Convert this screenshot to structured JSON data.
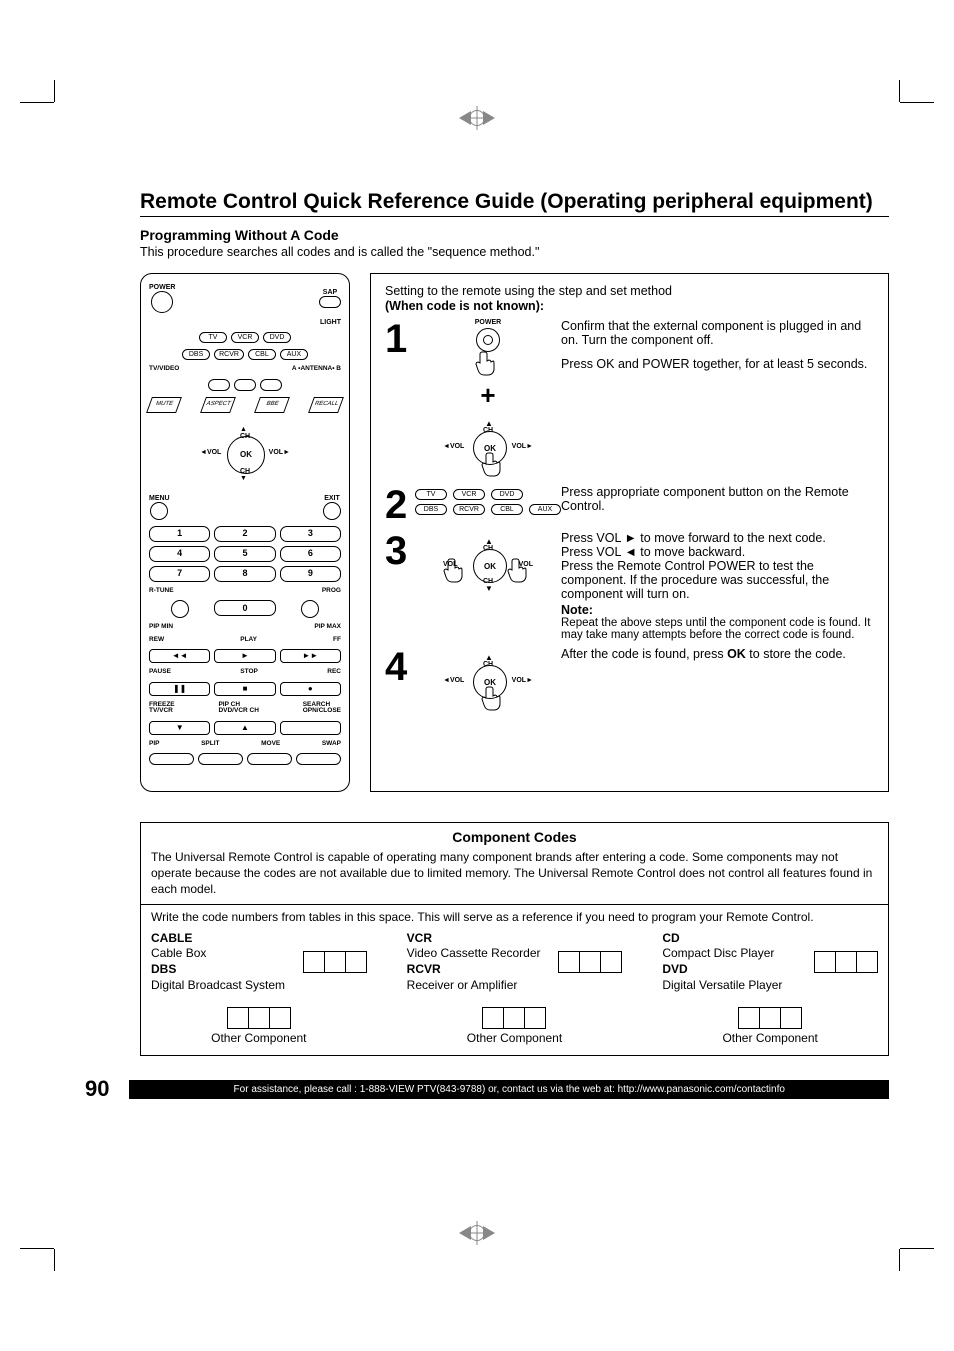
{
  "page_number": "90",
  "title": "Remote Control Quick Reference Guide (Operating peripheral equipment)",
  "subhead": "Programming Without A Code",
  "lead": "This procedure searches all codes and is called the \"sequence method.\"",
  "stepbox": {
    "setting_line": "Setting to the remote using the step and set method",
    "setting_sub": "(When code is not known):"
  },
  "steps": {
    "s1": {
      "num": "1",
      "p1": "Confirm that the external component is plugged in and on. Turn the component off.",
      "p2": "Press OK and POWER together, for at least 5 seconds."
    },
    "s2": {
      "num": "2",
      "p1": "Press appropriate component button on the Remote Control."
    },
    "s3": {
      "num": "3",
      "p1": "Press VOL ► to move forward to the next code.",
      "p2": "Press VOL ◄ to move backward.",
      "p3": "Press the Remote Control POWER to test the component. If the procedure was successful, the component will turn on.",
      "note_h": "Note:",
      "note_t": "Repeat the above steps until the component code is found. It may take many attempts before the correct code is found."
    },
    "s4": {
      "num": "4",
      "p1a": "After the code is found, press ",
      "p1b": "OK",
      "p1c": " to store the code."
    }
  },
  "plus": "+",
  "nav": {
    "ok": "OK",
    "ch": "CH",
    "vol": "VOL"
  },
  "remote": {
    "power": "POWER",
    "sap": "SAP",
    "light": "LIGHT",
    "tv": "TV",
    "vcr": "VCR",
    "dvd": "DVD",
    "dbs": "DBS",
    "rcvr": "RCVR",
    "cbl": "CBL",
    "aux": "AUX",
    "tvvideo": "TV/VIDEO",
    "aant": "A •ANTENNA• B",
    "mute": "MUTE",
    "aspect": "ASPECT",
    "bbe": "BBE",
    "recall": "RECALL",
    "menu": "MENU",
    "exit": "EXIT",
    "n1": "1",
    "n2": "2",
    "n3": "3",
    "n4": "4",
    "n5": "5",
    "n6": "6",
    "n7": "7",
    "n8": "8",
    "n9": "9",
    "n0": "0",
    "rtune": "R-TUNE",
    "prog": "PROG",
    "pipmin": "PIP MIN",
    "pipmax": "PIP MAX",
    "rew": "REW",
    "play": "PLAY",
    "ff": "FF",
    "pause": "PAUSE",
    "stop": "STOP",
    "rec": "REC",
    "freeze": "FREEZE",
    "tvvcr": "TV/VCR",
    "pipch": "PIP CH",
    "dvdvcrch": "DVD/VCR CH",
    "search": "SEARCH",
    "opnclose": "OPN/CLOSE",
    "pip": "PIP",
    "split": "SPLIT",
    "move": "MOVE",
    "swap": "SWAP"
  },
  "codes": {
    "heading": "Component Codes",
    "para1": "The Universal Remote Control is capable of operating many component brands after entering a code. Some components may not operate because the codes are not available due to limited memory. The Universal Remote Control does not control all features found in each model.",
    "para2": "Write the code numbers from tables in this space. This will serve as a reference if you need to program your Remote Control.",
    "cells": [
      {
        "l1": "CABLE",
        "l2": "Cable Box",
        "l3": "DBS",
        "l4": "Digital Broadcast System"
      },
      {
        "l1": "VCR",
        "l2": "Video Cassette Recorder",
        "l3": "RCVR",
        "l4": "Receiver or Amplifier"
      },
      {
        "l1": "CD",
        "l2": "Compact Disc Player",
        "l3": "DVD",
        "l4": "Digital Versatile Player"
      }
    ],
    "other": "Other Component"
  },
  "footer_text": "For assistance, please call : 1-888-VIEW PTV(843-9788) or, contact us via the web at: http://www.panasonic.com/contactinfo"
}
